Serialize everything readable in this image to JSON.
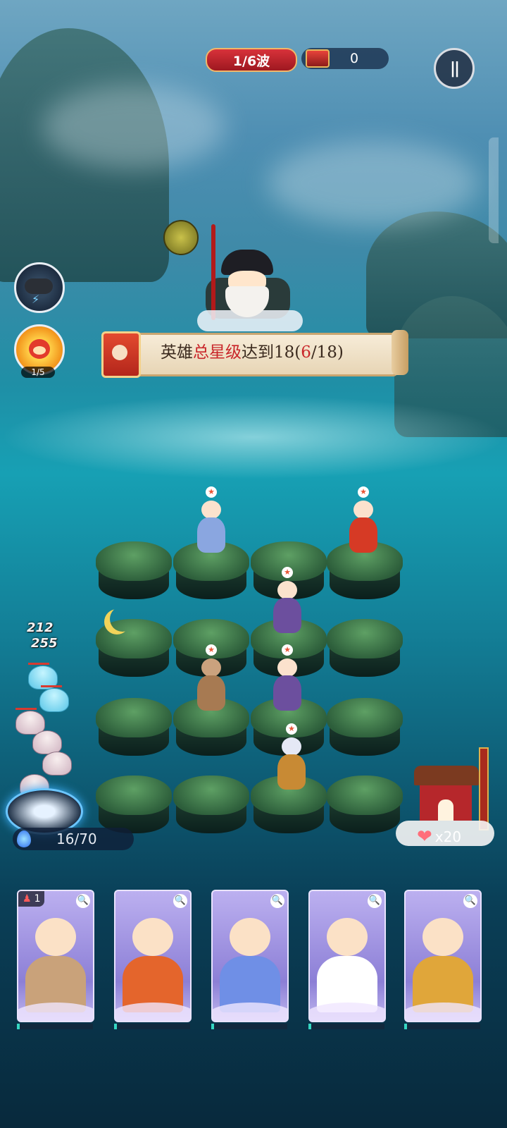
{
  "hud": {
    "wave": "1/6波",
    "coins": "0",
    "skill_count": "1/5",
    "energy": "16/70",
    "lives": "x20"
  },
  "quest": {
    "prefix": "英雄",
    "highlight": "总星级",
    "middle": "达到18(",
    "current": "6",
    "suffix": "/18)"
  },
  "damage": [
    "212",
    "255"
  ],
  "hero_cards": [
    {
      "name": "monkey-staff-hero",
      "count": "1",
      "body_color": "#c9a27a"
    },
    {
      "name": "fat-general-hero",
      "count": "",
      "body_color": "#e4652c"
    },
    {
      "name": "opera-lady-hero",
      "count": "",
      "body_color": "#6f8fe6"
    },
    {
      "name": "dancer-hero",
      "count": "",
      "body_color": "#ffffff"
    },
    {
      "name": "warrior-rider-hero",
      "count": "",
      "body_color": "#e0a63a"
    }
  ],
  "icons": {
    "pause": "pause-icon",
    "coin": "coin-chest-icon",
    "search": "magnifier-icon",
    "heart": "heart-icon",
    "energy": "water-drop-icon"
  }
}
